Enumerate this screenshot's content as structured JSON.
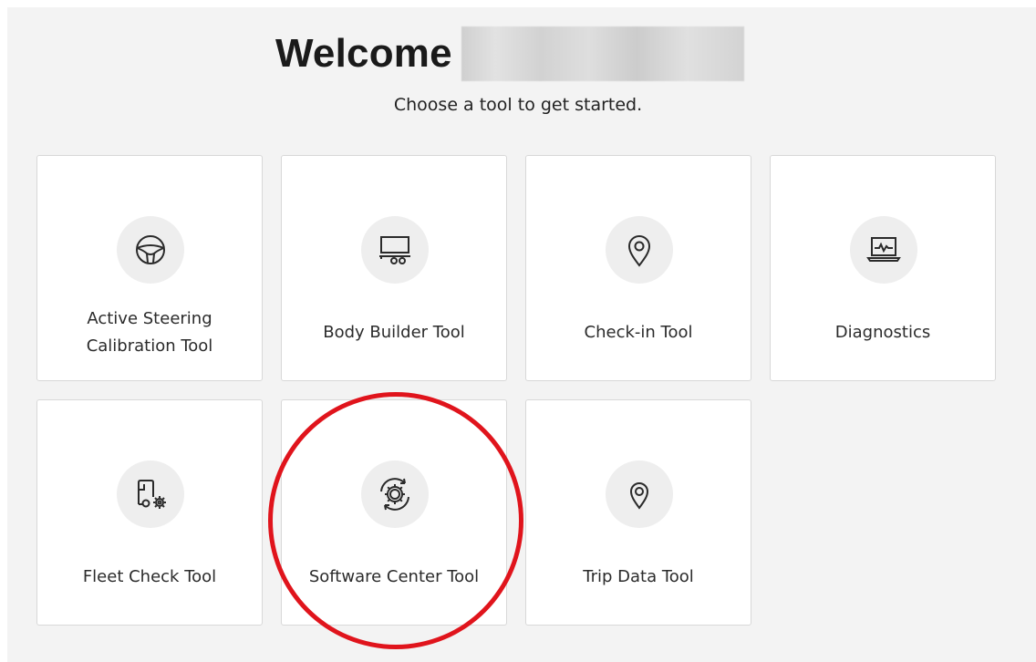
{
  "header": {
    "welcome": "Welcome",
    "subtitle": "Choose a tool to get started."
  },
  "tools": [
    {
      "label": "Active Steering Calibration Tool",
      "icon": "steering-wheel-icon"
    },
    {
      "label": "Body Builder Tool",
      "icon": "truck-body-icon"
    },
    {
      "label": "Check-in Tool",
      "icon": "location-pin-icon"
    },
    {
      "label": "Diagnostics",
      "icon": "laptop-pulse-icon"
    },
    {
      "label": "Fleet Check Tool",
      "icon": "truck-gear-icon"
    },
    {
      "label": "Software Center Tool",
      "icon": "gear-refresh-icon"
    },
    {
      "label": "Trip Data Tool",
      "icon": "location-pin-icon"
    }
  ],
  "colors": {
    "background": "#f3f3f3",
    "card": "#ffffff",
    "icon_circle": "#eeeeee",
    "highlight": "#e0141c"
  }
}
